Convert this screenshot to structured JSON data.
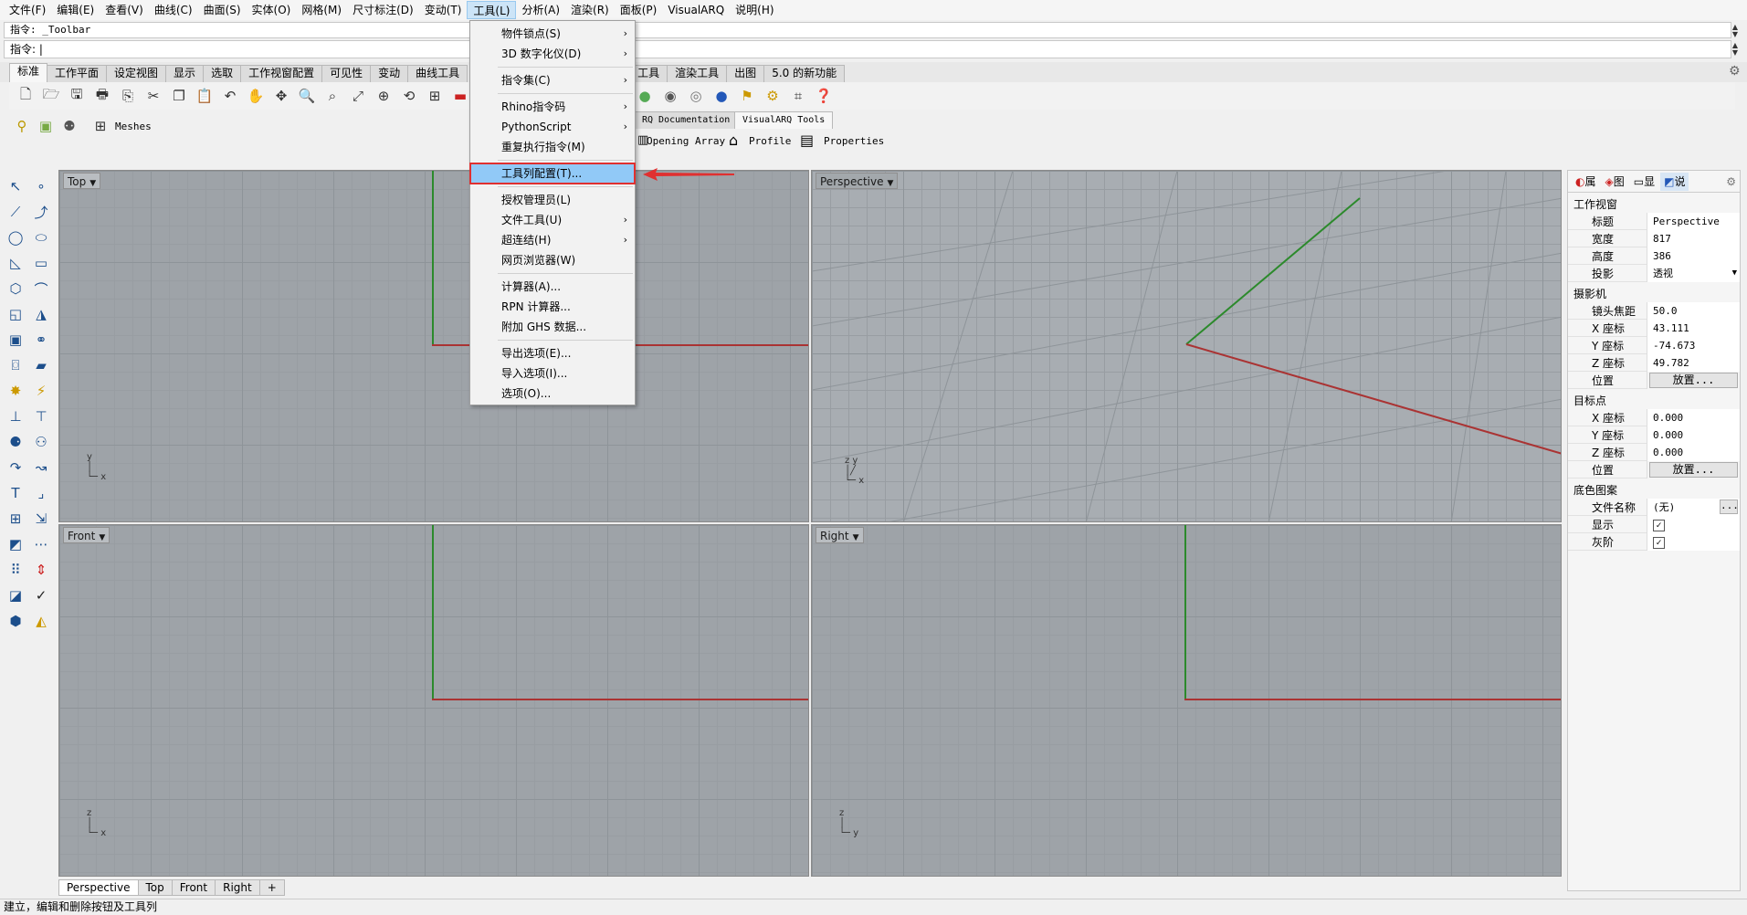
{
  "menubar": [
    "文件(F)",
    "编辑(E)",
    "查看(V)",
    "曲线(C)",
    "曲面(S)",
    "实体(O)",
    "网格(M)",
    "尺寸标注(D)",
    "变动(T)",
    "工具(L)",
    "分析(A)",
    "渲染(R)",
    "面板(P)",
    "VisualARQ",
    "说明(H)"
  ],
  "command": {
    "history": "指令: _Toolbar",
    "prompt": "指令:"
  },
  "toolbar_tabs": [
    "标准",
    "工作平面",
    "设定视图",
    "显示",
    "选取",
    "工作视窗配置",
    "可见性",
    "变动",
    "曲线工具",
    "工具",
    "渲染工具",
    "出图",
    "5.0 的新功能"
  ],
  "row2": {
    "meshes": "Meshes",
    "tabs": [
      "RQ Documentation",
      "VisualARQ Tools"
    ],
    "opening_array": "Opening Array",
    "profile": "Profile",
    "properties": "Properties"
  },
  "dropdown": {
    "groups": [
      [
        {
          "label": "物件锁点(S)",
          "sub": true
        },
        {
          "label": "3D 数字化仪(D)",
          "sub": true
        }
      ],
      [
        {
          "label": "指令集(C)",
          "sub": true
        }
      ],
      [
        {
          "label": "Rhino指令码",
          "sub": true
        },
        {
          "label": "PythonScript",
          "sub": true
        },
        {
          "label": "重复执行指令(M)",
          "sub": false
        }
      ],
      [
        {
          "label": "工具列配置(T)...",
          "sub": false,
          "highlighted": true
        }
      ],
      [
        {
          "label": "授权管理员(L)",
          "sub": false
        },
        {
          "label": "文件工具(U)",
          "sub": true
        },
        {
          "label": "超连结(H)",
          "sub": true
        },
        {
          "label": "网页浏览器(W)",
          "sub": false
        }
      ],
      [
        {
          "label": "计算器(A)...",
          "sub": false
        },
        {
          "label": "RPN 计算器...",
          "sub": false
        },
        {
          "label": "附加 GHS 数据...",
          "sub": false
        }
      ],
      [
        {
          "label": "导出选项(E)...",
          "sub": false
        },
        {
          "label": "导入选项(I)...",
          "sub": false
        },
        {
          "label": "选项(O)...",
          "sub": false
        }
      ]
    ]
  },
  "viewports": {
    "top": "Top",
    "perspective": "Perspective",
    "front": "Front",
    "right": "Right"
  },
  "viewport_tabs": [
    "Perspective",
    "Top",
    "Front",
    "Right",
    "+"
  ],
  "status": "建立，编辑和删除按钮及工具列",
  "panel": {
    "tabs": [
      "属",
      "图",
      "显",
      "说"
    ],
    "sec1": "工作视窗",
    "sec1_rows": [
      {
        "k": "标题",
        "v": "Perspective"
      },
      {
        "k": "宽度",
        "v": "817"
      },
      {
        "k": "高度",
        "v": "386"
      },
      {
        "k": "投影",
        "v": "透视"
      }
    ],
    "sec2": "摄影机",
    "sec2_rows": [
      {
        "k": "镜头焦距",
        "v": "50.0"
      },
      {
        "k": "X 座标",
        "v": "43.111"
      },
      {
        "k": "Y 座标",
        "v": "-74.673"
      },
      {
        "k": "Z 座标",
        "v": "49.782"
      },
      {
        "k": "位置",
        "v": "放置..."
      }
    ],
    "sec3": "目标点",
    "sec3_rows": [
      {
        "k": "X 座标",
        "v": "0.000"
      },
      {
        "k": "Y 座标",
        "v": "0.000"
      },
      {
        "k": "Z 座标",
        "v": "0.000"
      },
      {
        "k": "位置",
        "v": "放置..."
      }
    ],
    "sec4": "底色图案",
    "sec4_rows": [
      {
        "k": "文件名称",
        "v": "(无)"
      },
      {
        "k": "显示",
        "v": "✓"
      },
      {
        "k": "灰阶",
        "v": "✓"
      }
    ]
  },
  "colors": {
    "x_axis": "#a33",
    "y_axis": "#2c8a2c",
    "grid": "#9ea3a8",
    "highlight": "#91c9f7",
    "arrow": "#e03030"
  }
}
